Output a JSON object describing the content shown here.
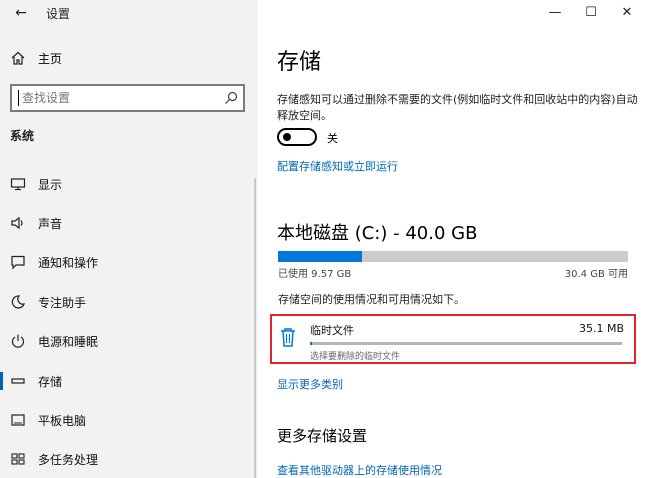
{
  "window": {
    "title": "设置",
    "back_icon": "←",
    "minimize_icon": "—",
    "maximize_icon": "☐",
    "close_icon": "✕"
  },
  "sidebar": {
    "home_label": "主页",
    "search_placeholder": "查找设置",
    "section_label": "系统",
    "items": [
      {
        "label": "显示",
        "icon": "monitor-icon"
      },
      {
        "label": "声音",
        "icon": "speaker-icon"
      },
      {
        "label": "通知和操作",
        "icon": "notification-icon"
      },
      {
        "label": "专注助手",
        "icon": "moon-icon"
      },
      {
        "label": "电源和睡眠",
        "icon": "power-icon"
      },
      {
        "label": "存储",
        "icon": "storage-icon",
        "active": true
      },
      {
        "label": "平板电脑",
        "icon": "tablet-icon"
      },
      {
        "label": "多任务处理",
        "icon": "multitask-icon"
      }
    ]
  },
  "main": {
    "title": "存储",
    "description": "存储感知可以通过删除不需要的文件(例如临时文件和回收站中的内容)自动释放空间。",
    "toggle_state_label": "关",
    "config_link": "配置存储感知或立即运行",
    "disk_title": "本地磁盘 (C:) - 40.0 GB",
    "used_label": "已使用 9.57 GB",
    "free_label": "30.4 GB 可用",
    "used_fraction": 0.239,
    "usage_desc": "存储空间的使用情况和可用情况如下。",
    "temp_files": {
      "name": "临时文件",
      "size": "35.1 MB",
      "hint": "选择要删除的临时文件",
      "fill_fraction": 0.004
    },
    "show_more_link": "显示更多类别",
    "more_settings_title": "更多存储设置",
    "other_drives_link": "查看其他驱动器上的存储使用情况"
  },
  "colors": {
    "accent": "#0078d7",
    "link": "#0067b8",
    "highlight_border": "#e0242a"
  }
}
